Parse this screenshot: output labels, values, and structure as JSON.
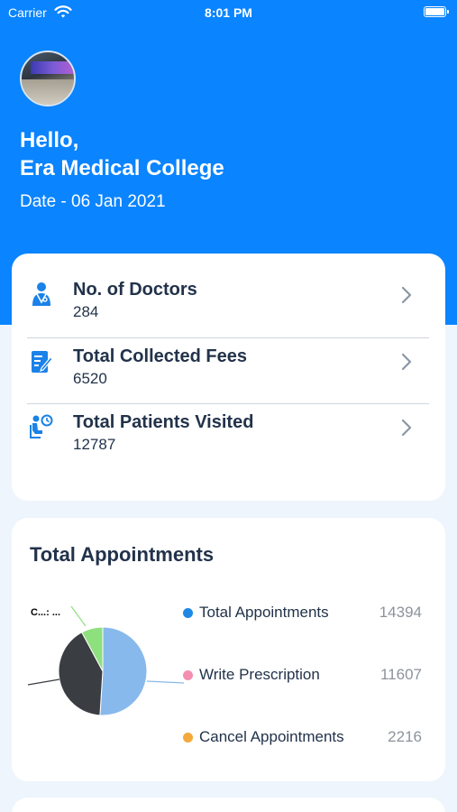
{
  "status_bar": {
    "carrier": "Carrier",
    "time": "8:01 PM"
  },
  "header": {
    "greeting": "Hello,",
    "name": "Era Medical College",
    "date": "Date - 06 Jan 2021",
    "background_color": "#0a84ff"
  },
  "stats": [
    {
      "title": "No. of Doctors",
      "value": "284",
      "icon": "doctor-icon"
    },
    {
      "title": "Total Collected Fees",
      "value": "6520",
      "icon": "fees-edit-icon"
    },
    {
      "title": "Total Patients Visited",
      "value": "12787",
      "icon": "patient-waiting-icon"
    }
  ],
  "appointments": {
    "title": "Total Appointments",
    "pie_small_label": "C...: ..."
  },
  "chart_data": {
    "type": "pie",
    "series": [
      {
        "name": "Total Appointments",
        "value": 14394,
        "color": "#88b9ec"
      },
      {
        "name": "Write Prescription",
        "value": 11607,
        "color": "#3a3d42"
      },
      {
        "name": "Cancel Appointments",
        "value": 2216,
        "color": "#8ee07f"
      }
    ],
    "legend": [
      {
        "label": "Total Appointments",
        "value": "14394",
        "color": "#1e88e5"
      },
      {
        "label": "Write Prescription",
        "value": "11607",
        "color": "#f48fb1"
      },
      {
        "label": "Cancel Appointments",
        "value": "2216",
        "color": "#f4a93b"
      }
    ],
    "legend_position": "right"
  }
}
